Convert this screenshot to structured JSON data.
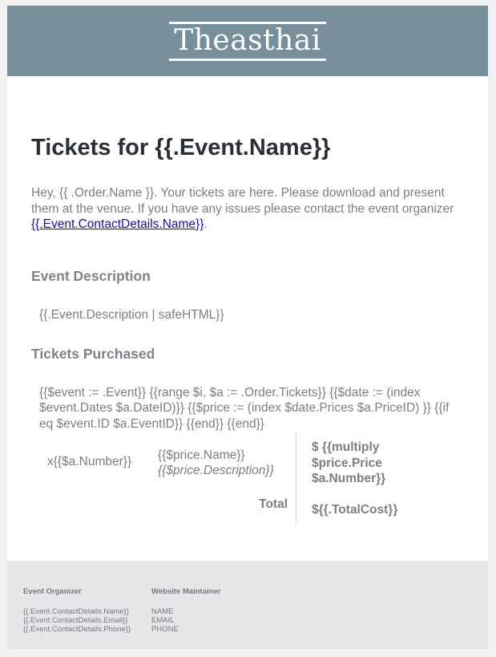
{
  "brand": {
    "logo_text": "Theasthai"
  },
  "title": "Tickets for {{.Event.Name}}",
  "intro": {
    "text": "Hey, {{ .Order.Name }}. Your tickets are here. Please download and present them at the venue. If you have any issues please contact the event organizer ",
    "link": "{{.Event.ContactDetails.Name}}",
    "end": "."
  },
  "sections": {
    "description_heading": "Event Description",
    "description_text": "{{.Event.Description | safeHTML}}",
    "tickets_heading": "Tickets Purchased",
    "template_text": "{{$event := .Event}} {{range $i, $a := .Order.Tickets}} {{$date := (index $event.Dates $a.DateID)}} {{$price := (index $date.Prices $a.PriceID) }} {{if eq $event.ID $a.EventID}} {{end}} {{end}}"
  },
  "ticket_row": {
    "quantity": "x{{$a.Number}}",
    "price_name": "{{$price.Name}}",
    "price_description": "{{$price.Description}}",
    "line_total": "$ {{multiply $price.Price $a.Number}}",
    "total_label": "Total",
    "total_cost": "${{.TotalCost}}"
  },
  "footer": {
    "organizer": {
      "heading": "Event Organizer",
      "name": "{{.Event.ContactDetails.Name}}",
      "email": "{{.Event.ContactDetails.Email}}",
      "phone": "{{.Event.ContactDetails.Phone}}"
    },
    "maintainer": {
      "heading": "Website Maintainer",
      "name": "NAME",
      "email": "EMAIL",
      "phone": "PHONE"
    }
  }
}
